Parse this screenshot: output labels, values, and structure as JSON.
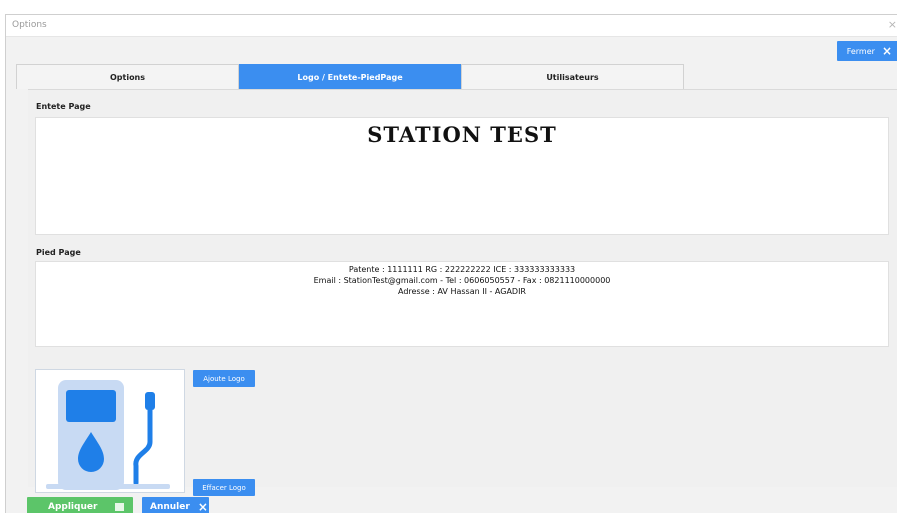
{
  "window": {
    "title": "Options",
    "title_close": "×"
  },
  "close_button": {
    "label": "Fermer",
    "icon": "×"
  },
  "tabs": [
    {
      "label": "Options",
      "active": false
    },
    {
      "label": "Logo / Entete-PiedPage",
      "active": true
    },
    {
      "label": "Utilisateurs",
      "active": false
    }
  ],
  "header_section": {
    "label": "Entete Page",
    "content": "STATION  TEST"
  },
  "footer_section": {
    "label": "Pied Page",
    "lines": [
      "Patente : 1111111  RG : 222222222  ICE : 333333333333",
      "Email : StationTest@gmail.com - Tel : 0606050557   -   Fax : 0821110000000",
      "Adresse :   AV Hassan II - AGADIR"
    ]
  },
  "logo": {
    "icon": "fuel-pump-icon",
    "add_label": "Ajoute Logo",
    "delete_label": "Effacer Logo"
  },
  "actions": {
    "apply_label": "Appliquer",
    "cancel_label": "Annuler",
    "cancel_icon": "×"
  },
  "colors": {
    "primary": "#3b8ef0",
    "success": "#5cc569",
    "pump_light": "#c8daf3",
    "pump_dark": "#1f7fe8"
  }
}
